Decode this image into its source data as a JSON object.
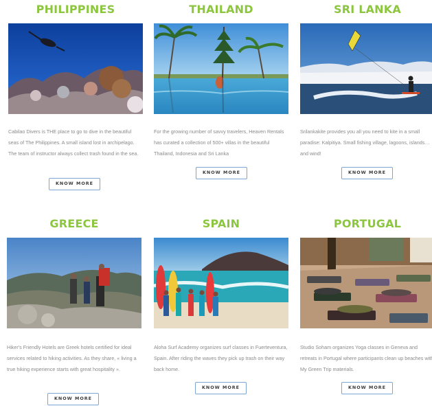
{
  "destinations": [
    {
      "title": "PHILIPPINES",
      "photo": "scuba-diver-coral-reef-photo",
      "description": "Cabilao Divers is THE place to go to dive in the beautiful seas of The Philippines. A small island lost in archipelago. The team of instructor always collect trash found in the sea.",
      "button": "KNOW MORE"
    },
    {
      "title": "THAILAND",
      "photo": "infinity-pool-palm-trees-photo",
      "description": "For the growing number of savvy travelers, Heaven Rentals has curated a collection of 500+ villas in the beautiful Thailand, Indonesia and Sri Lanka",
      "button": "KNOW MORE"
    },
    {
      "title": "SRI LANKA",
      "photo": "kitesurfer-ocean-photo",
      "description": "Srilankakite provides you all you need to kite in a small paradise: Kalpitiya. Small fishing village, lagoons, islands… and wind!",
      "button": "KNOW MORE"
    },
    {
      "title": "GREECE",
      "photo": "hikers-mountain-trail-photo",
      "description": "Hiker's Friendly Hotels are Greek hotels certified for ideal services related to hiking activities. As they share, « living a true hiking experience starts with great hospitality ».",
      "button": "KNOW MORE"
    },
    {
      "title": "SPAIN",
      "photo": "surf-group-beach-photo",
      "description": "Aloha Surf Academy organizes surf classes in Fuerteventura, Spain. After riding the waves they pick up trash on their way back home.",
      "button": "KNOW MORE"
    },
    {
      "title": "PORTUGAL",
      "photo": "yoga-class-floor-photo",
      "description": "Studio Soham organizes Yoga classes in Geneva and retreats in Portugal where participants clean up beaches with My Green Trip materials.",
      "button": "KNOW MORE"
    }
  ],
  "colors": {
    "title_green": "#8cc63f",
    "button_border": "#7aa6d6",
    "body_text": "#8a8a8a"
  }
}
